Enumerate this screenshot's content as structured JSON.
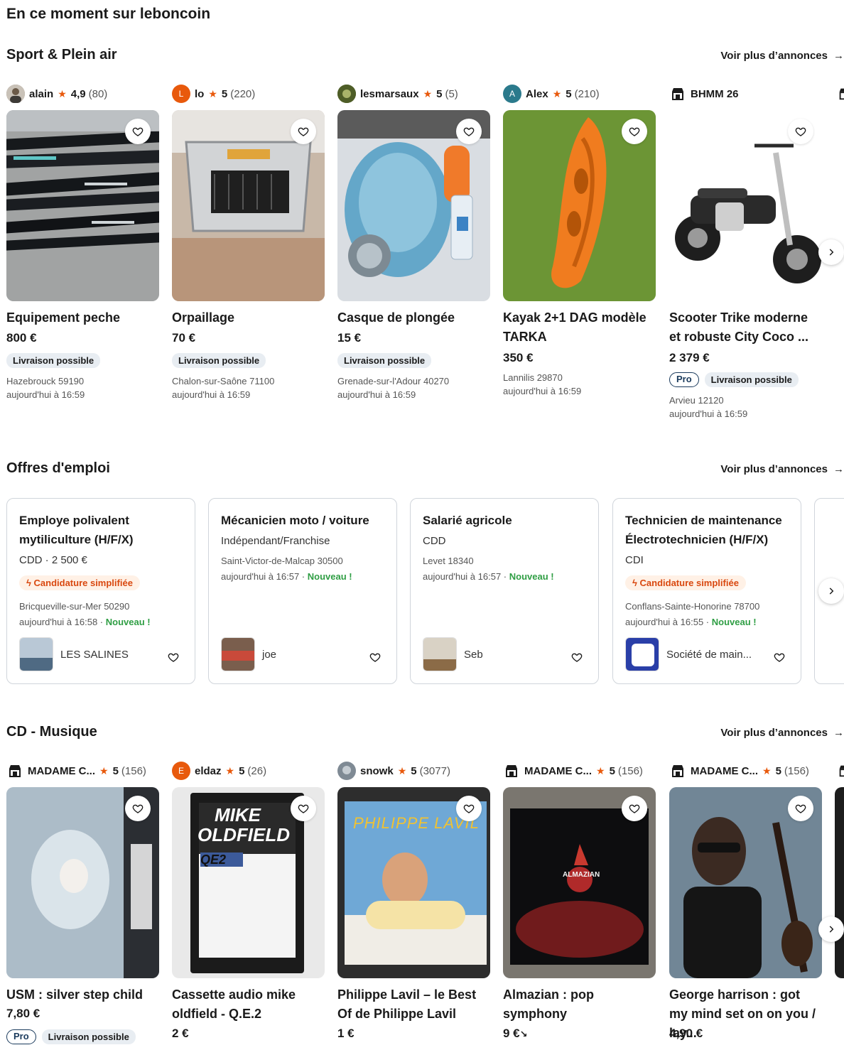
{
  "page_title": "En ce moment sur leboncoin",
  "more_label": "Voir plus d’annonces",
  "more_arrow": "→",
  "sections": {
    "sport": {
      "title": "Sport & Plein air",
      "cards": [
        {
          "seller": "alain",
          "rating": "4,9",
          "count": "(80)",
          "title": "Equipement peche",
          "price": "800 €",
          "badges": [
            "Livraison possible"
          ],
          "location": "Hazebrouck 59190",
          "time": "aujourd'hui à 16:59"
        },
        {
          "seller": "lo",
          "avatar_letter": "L",
          "rating": "5",
          "count": "(220)",
          "title": "Orpaillage",
          "price": "70 €",
          "badges": [
            "Livraison possible"
          ],
          "location": "Chalon-sur-Saône 71100",
          "time": "aujourd'hui à 16:59"
        },
        {
          "seller": "lesmarsaux",
          "rating": "5",
          "count": "(5)",
          "title": "Casque de plongée",
          "price": "15 €",
          "badges": [
            "Livraison possible"
          ],
          "location": "Grenade-sur-l'Adour 40270",
          "time": "aujourd'hui à 16:59"
        },
        {
          "seller": "Alex",
          "avatar_letter": "A",
          "rating": "5",
          "count": "(210)",
          "title": "Kayak 2+1 DAG modèle TARKA",
          "price": "350 €",
          "location": "Lannilis 29870",
          "time": "aujourd'hui à 16:59"
        },
        {
          "seller": "BHMM 26",
          "title": "Scooter Trike moderne et robuste City Coco ...",
          "price": "2 379 €",
          "pro": "Pro",
          "badges": [
            "Livraison possible"
          ],
          "location": "Arvieu 12120",
          "time": "aujourd'hui à 16:59"
        }
      ]
    },
    "jobs": {
      "title": "Offres d'emploi",
      "cards": [
        {
          "title": "Employe polivalent mytiliculture (H/F/X)",
          "contract": "CDD",
          "salary": "2 500 €",
          "simplified": "Candidature simplifiée",
          "location": "Bricqueville-sur-Mer 50290",
          "time": "aujourd'hui à 16:58",
          "new": "Nouveau !",
          "company": "LES SALINES"
        },
        {
          "title": "Mécanicien moto / voiture",
          "contract": "Indépendant/Franchise",
          "location": "Saint-Victor-de-Malcap 30500",
          "time": "aujourd'hui à 16:57",
          "new": "Nouveau !",
          "company": "joe"
        },
        {
          "title": "Salarié agricole",
          "contract": "CDD",
          "location": "Levet 18340",
          "time": "aujourd'hui à 16:57",
          "new": "Nouveau !",
          "company": "Seb"
        },
        {
          "title": "Technicien de maintenance Électrotechnicien (H/F/X)",
          "contract": "CDI",
          "simplified": "Candidature simplifiée",
          "location": "Conflans-Sainte-Honorine 78700",
          "time": "aujourd'hui à 16:55",
          "new": "Nouveau !",
          "company": "Société de main..."
        }
      ]
    },
    "music": {
      "title": "CD - Musique",
      "cards": [
        {
          "seller": "MADAME C...",
          "rating": "5",
          "count": "(156)",
          "title": "USM : silver step child",
          "price": "7,80 €",
          "pro": "Pro",
          "badges": [
            "Livraison possible"
          ]
        },
        {
          "seller": "eldaz",
          "avatar_letter": "E",
          "rating": "5",
          "count": "(26)",
          "title": "Cassette audio mike oldfield - Q.E.2",
          "price": "2 €",
          "cover_text_1": "MIKE",
          "cover_text_2": "OLDFIELD",
          "cover_text_3": "QE2"
        },
        {
          "seller": "snowk",
          "rating": "5",
          "count": "(3077)",
          "title": "Philippe Lavil – le Best Of de Philippe Lavil",
          "price": "1 €",
          "cover_text_1": "PHILIPPE LAVIL"
        },
        {
          "seller": "MADAME C...",
          "rating": "5",
          "count": "(156)",
          "title": "Almazian : pop symphony",
          "price": "9 €",
          "cover_text_1": "ALMAZIAN"
        },
        {
          "seller": "MADAME C...",
          "rating": "5",
          "count": "(156)",
          "title": "George harrison : got my mind set on on you / lay...",
          "price": "4,90 €"
        }
      ]
    }
  },
  "colors": {
    "star": "#e8590c",
    "new": "#2f9e44",
    "simplified": "#d9480f",
    "pro": "#1a3a5c"
  },
  "icons": {
    "favorite": "heart-icon",
    "next": "chevron-right-icon",
    "star": "star-icon",
    "store": "store-icon",
    "lightning": "lightning-icon"
  }
}
